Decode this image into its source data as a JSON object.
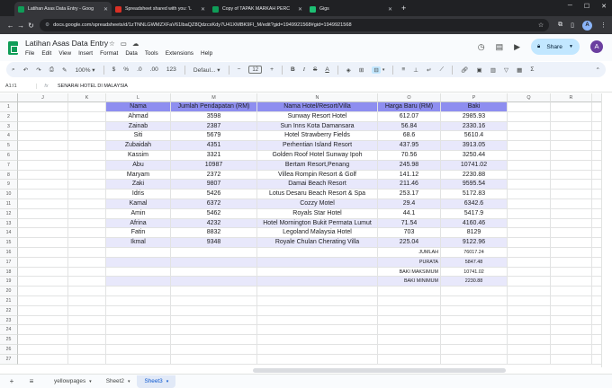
{
  "browser": {
    "tabs": [
      {
        "title": "Latihan Asas Data Entry - Goog",
        "color": "#0f9d58",
        "active": true
      },
      {
        "title": "Spreadsheet shared with you: 'L",
        "color": "#d93025",
        "active": false
      },
      {
        "title": "Copy of TAPAK MARKAH PERC",
        "color": "#0f9d58",
        "active": false
      },
      {
        "title": "Gigs",
        "color": "#1dbf73",
        "active": false
      }
    ],
    "url": "docs.google.com/spreadsheets/d/1zTNNLGWMZXFaV61lbaQZ8QdzcxKdy7U41XMBK9FI_M/edit?gid=1949921568#gid=1949921568",
    "profile_initial": "A"
  },
  "doc": {
    "title": "Latihan Asas Data Entry",
    "menu": [
      "File",
      "Edit",
      "View",
      "Insert",
      "Format",
      "Data",
      "Tools",
      "Extensions",
      "Help"
    ],
    "share_label": "Share",
    "avatar_initial": "A"
  },
  "toolbar": {
    "zoom": "100%",
    "currency": "$",
    "percent": "%",
    "dec_minus": ".0",
    "dec_plus": ".00",
    "format": "123",
    "font": "Defaul...",
    "font_size": "12",
    "minus": "−",
    "plus": "+",
    "bold": "B",
    "italic": "I",
    "strike": "S",
    "text_color": "A"
  },
  "formula_bar": {
    "cell_ref": "A1:I1",
    "fx": "fx",
    "value": "SENARAI HOTEL DI MALAYSIA"
  },
  "sheet": {
    "columns": [
      "J",
      "K",
      "L",
      "M",
      "N",
      "O",
      "P",
      "Q",
      "R",
      "S"
    ],
    "rows": [
      "1",
      "2",
      "3",
      "4",
      "5",
      "6",
      "7",
      "8",
      "9",
      "10",
      "11",
      "12",
      "13",
      "14",
      "15",
      "16",
      "17",
      "18",
      "19",
      "20",
      "21",
      "22",
      "23",
      "24",
      "25",
      "26",
      "27"
    ],
    "header": [
      "Nama",
      "Jumlah Pendapatan (RM)",
      "Nama Hotel/Resort/Villa",
      "Harga Baru (RM)",
      "Baki"
    ],
    "data": [
      [
        "Ahmad",
        "3598",
        "Sunway Resort Hotel",
        "612.07",
        "2985.93"
      ],
      [
        "Zainab",
        "2387",
        "Sun Inns Kota Damansara",
        "56.84",
        "2330.16"
      ],
      [
        "Siti",
        "5679",
        "Hotel Strawberry Fields",
        "68.6",
        "5610.4"
      ],
      [
        "Zubaidah",
        "4351",
        "Perhentian Island Resort",
        "437.95",
        "3913.05"
      ],
      [
        "Kassim",
        "3321",
        "Golden Roof Hotel Sunway Ipoh",
        "70.56",
        "3250.44"
      ],
      [
        "Abu",
        "10987",
        "Bertam Resort,Penang",
        "245.98",
        "10741.02"
      ],
      [
        "Maryam",
        "2372",
        "Villea Rompin Resort & Golf",
        "141.12",
        "2230.88"
      ],
      [
        "Zaki",
        "9807",
        "Damai Beach Resort",
        "211.46",
        "9595.54"
      ],
      [
        "Idris",
        "5426",
        "Lotus Desaru Beach Resort & Spa",
        "253.17",
        "5172.83"
      ],
      [
        "Kamal",
        "6372",
        "Cozzy Motel",
        "29.4",
        "6342.6"
      ],
      [
        "Amin",
        "5462",
        "Royals Star Hotel",
        "44.1",
        "5417.9"
      ],
      [
        "Afrina",
        "4232",
        "Hotel Mornington Bukit Permata Lumut",
        "71.54",
        "4160.46"
      ],
      [
        "Fatin",
        "8832",
        "Legoland Malaysia Hotel",
        "703",
        "8129"
      ],
      [
        "Ikmal",
        "9348",
        "Royale Chulan Cherating Villa",
        "225.04",
        "9122.96"
      ]
    ],
    "summary": [
      [
        "JUMLAH",
        "76017.24"
      ],
      [
        "PURATA",
        "5847.48"
      ],
      [
        "BAKI MAKSIMUM",
        "10741.02"
      ],
      [
        "BAKI MINIMUM",
        "2230.88"
      ]
    ]
  },
  "sheet_tabs": [
    "yellowpages",
    "Sheet2",
    "Sheet3"
  ],
  "active_sheet": "Sheet3",
  "colors": {
    "header_fill": "#8e8ef0",
    "band_fill": "#e8e8fb",
    "selected_tab": "#0b57d0"
  }
}
